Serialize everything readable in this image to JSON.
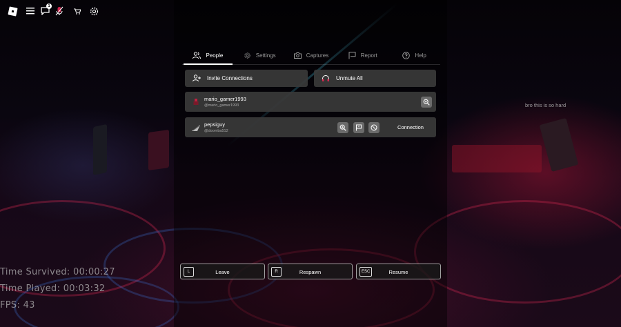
{
  "topbar": {
    "icons": [
      "roblox-logo-icon",
      "menu-icon",
      "chat-icon",
      "mic-muted-icon",
      "cart-icon",
      "gear-icon"
    ],
    "chat_badge": "1"
  },
  "tabs": [
    {
      "label": "People",
      "icon": "people-icon",
      "active": true
    },
    {
      "label": "Settings",
      "icon": "gear-icon",
      "active": false
    },
    {
      "label": "Captures",
      "icon": "camera-icon",
      "active": false
    },
    {
      "label": "Report",
      "icon": "flag-icon",
      "active": false
    },
    {
      "label": "Help",
      "icon": "help-icon",
      "active": false
    }
  ],
  "actions": {
    "invite_label": "Invite Connections",
    "unmute_label": "Unmute All"
  },
  "players": [
    {
      "username": "mario_gamer1993",
      "handle": "@mario_gamer1993",
      "self": true
    },
    {
      "username": "pepsiguy",
      "handle": "@doomba512",
      "connect_label": "Connection"
    }
  ],
  "chat_message": "bro this is so hard",
  "stats": {
    "time_survived": "Time Survived: 00:00:27",
    "time_played": "Time Played: 00:03:32",
    "fps": "FPS: 43"
  },
  "bottom_actions": [
    {
      "key": "L",
      "label": "Leave"
    },
    {
      "key": "R",
      "label": "Respawn"
    },
    {
      "key": "ESC",
      "label": "Resume"
    }
  ],
  "colors": {
    "panel": "#3a3a3a",
    "accent_red": "#d22850",
    "text_dim": "#9a9a9a"
  }
}
